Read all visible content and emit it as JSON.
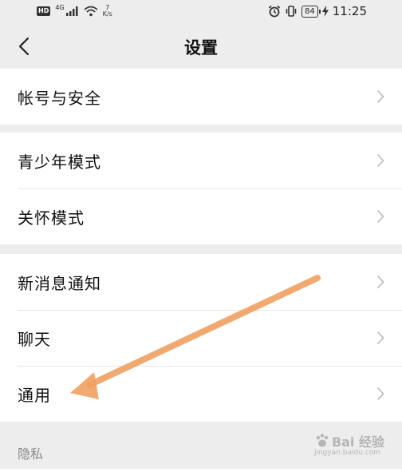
{
  "status_bar": {
    "network_badge": "HD",
    "network_type": "4G",
    "speed_value": "7",
    "speed_unit": "K/s",
    "battery": "84",
    "time": "11:25"
  },
  "navbar": {
    "title": "设置",
    "back_icon": "chevron-left-icon"
  },
  "groups": [
    {
      "items": [
        {
          "label": "帐号与安全"
        }
      ]
    },
    {
      "items": [
        {
          "label": "青少年模式"
        },
        {
          "label": "关怀模式"
        }
      ]
    },
    {
      "items": [
        {
          "label": "新消息通知"
        },
        {
          "label": "聊天"
        },
        {
          "label": "通用"
        }
      ]
    }
  ],
  "section_header": "隐私",
  "watermark": {
    "logo_text": "Bai 经验",
    "sub_text": "jingyan.baidu.com"
  },
  "colors": {
    "background": "#ededed",
    "card": "#ffffff",
    "arrow": "#f0a060",
    "chevron": "#b8b8b8"
  }
}
